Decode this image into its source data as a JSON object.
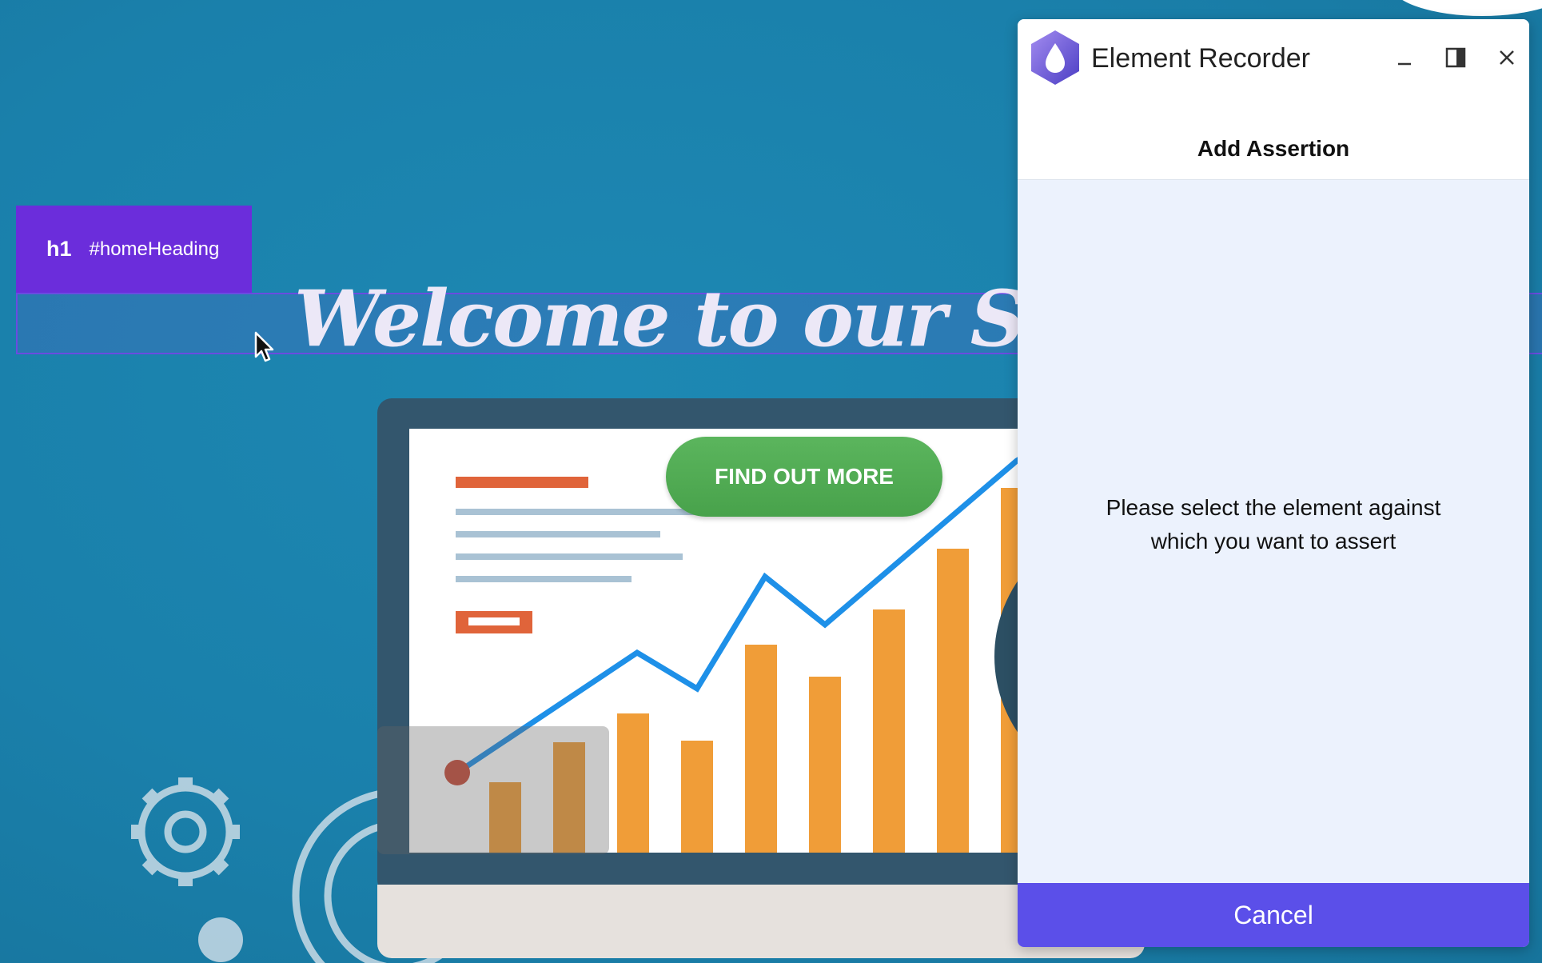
{
  "inspector": {
    "tag": "h1",
    "selector": "#homeHeading"
  },
  "page": {
    "heading": "Welcome to our Script C",
    "cta_label": "FIND OUT MORE"
  },
  "recorder": {
    "title": "Element Recorder",
    "subtitle": "Add Assertion",
    "message_line1": "Please select the element against",
    "message_line2": "which you want to assert",
    "cancel_label": "Cancel"
  },
  "colors": {
    "page_bg": "#1b82ad",
    "inspector_tag": "#6b2ddb",
    "cta_green": "#4fa851",
    "cancel_purple": "#5b4fe9",
    "chart_orange": "#f09d38",
    "chart_line": "#1e90e8"
  },
  "icons": [
    "cursor-arrow-icon",
    "recorder-logo-icon",
    "minimize-icon",
    "dock-panel-icon",
    "close-icon",
    "gear-icon"
  ]
}
